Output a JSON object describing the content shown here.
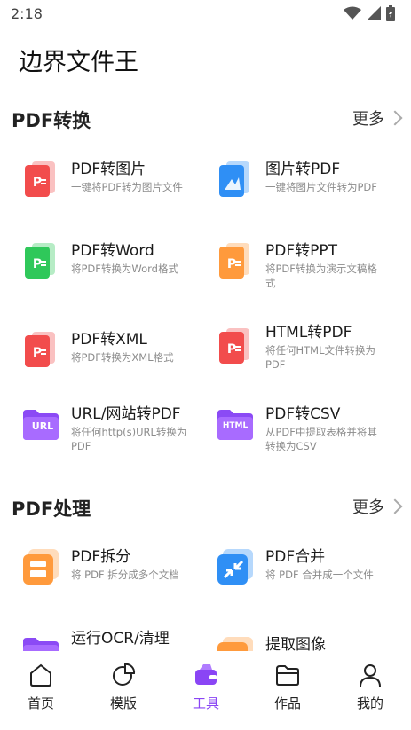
{
  "status": {
    "time": "2:18"
  },
  "app": {
    "title": "边界文件王"
  },
  "sections": [
    {
      "title": "PDF转换",
      "more": "更多"
    },
    {
      "title": "PDF处理",
      "more": "更多"
    }
  ],
  "tools": [
    {
      "name": "PDF转图片",
      "desc": "一键将PDF转为图片文件",
      "icon_text": "P"
    },
    {
      "name": "图片转PDF",
      "desc": "一键将图片文件转为PDF",
      "icon_text": ""
    },
    {
      "name": "PDF转Word",
      "desc": "将PDF转换为Word格式",
      "icon_text": "P"
    },
    {
      "name": "PDF转PPT",
      "desc": "将PDF转换为演示文稿格式",
      "icon_text": "P"
    },
    {
      "name": "PDF转XML",
      "desc": "将PDF转换为XML格式",
      "icon_text": "P"
    },
    {
      "name": "HTML转PDF",
      "desc": "将任何HTML文件转换为PDF",
      "icon_text": "P"
    },
    {
      "name": "URL/网站转PDF",
      "desc": "将任何http(s)URL转换为PDF",
      "icon_text": "URL"
    },
    {
      "name": "PDF转CSV",
      "desc": "从PDF中提取表格并将其转换为CSV",
      "icon_text": "HTML"
    },
    {
      "name": "PDF拆分",
      "desc": "将 PDF 拆分成多个文档",
      "icon_text": ""
    },
    {
      "name": "PDF合并",
      "desc": "将 PDF 合并成一个文件",
      "icon_text": ""
    },
    {
      "name": "运行OCR/清理",
      "desc": "",
      "icon_text": ""
    },
    {
      "name": "提取图像",
      "desc": "",
      "icon_text": ""
    }
  ],
  "nav": [
    {
      "label": "首页",
      "icon": "home-icon"
    },
    {
      "label": "模版",
      "icon": "template-icon"
    },
    {
      "label": "工具",
      "icon": "toolbox-icon",
      "active": true
    },
    {
      "label": "作品",
      "icon": "folder-icon"
    },
    {
      "label": "我的",
      "icon": "user-icon"
    }
  ],
  "colors": {
    "accent": "#8a45f5",
    "red": "#f24c4c",
    "blue": "#2f8ff5",
    "green": "#2fc85a",
    "orange": "#ff9a3c",
    "purple": "#8b4af5"
  }
}
